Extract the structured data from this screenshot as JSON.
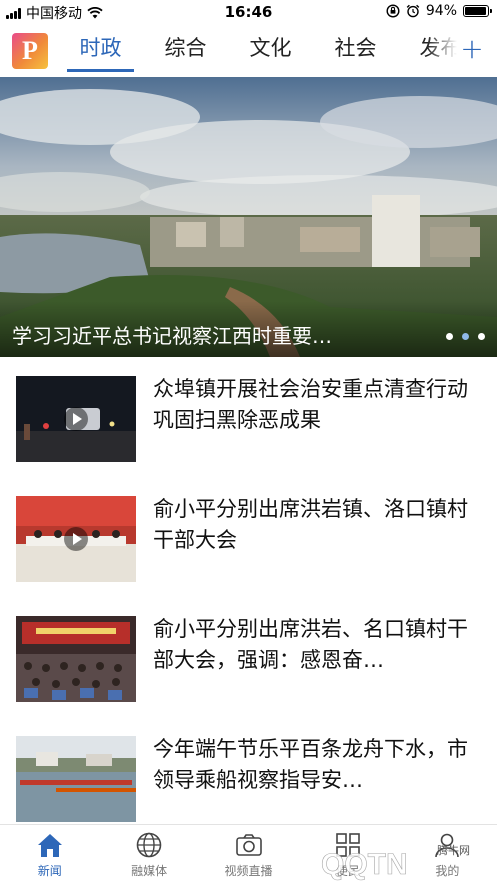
{
  "status_bar": {
    "carrier": "中国移动",
    "time": "16:46",
    "battery": "94%",
    "battery_level": 0.94
  },
  "header": {
    "logo_letter": "P",
    "tabs": [
      {
        "label": "时政",
        "active": true
      },
      {
        "label": "综合",
        "active": false
      },
      {
        "label": "文化",
        "active": false
      },
      {
        "label": "社会",
        "active": false
      },
      {
        "label": "发布",
        "active": false
      }
    ],
    "add_label": "+"
  },
  "banner": {
    "title": "学习习近平总书记视察江西时重要…",
    "page_count": 3,
    "active_page": 1
  },
  "news": [
    {
      "title": "众埠镇开展社会治安重点清查行动 巩固扫黑除恶成果",
      "has_video": true
    },
    {
      "title": "俞小平分别出席洪岩镇、洛口镇村干部大会",
      "has_video": true
    },
    {
      "title": "俞小平分别出席洪岩、名口镇村干部大会，强调：感恩奋…",
      "has_video": false
    },
    {
      "title": "今年端午节乐平百条龙舟下水，市领导乘船视察指导安…",
      "has_video": false
    }
  ],
  "bottom_nav": [
    {
      "label": "新闻",
      "icon": "home-icon",
      "active": true
    },
    {
      "label": "融媒体",
      "icon": "globe-icon",
      "active": false
    },
    {
      "label": "视频直播",
      "icon": "camera-icon",
      "active": false
    },
    {
      "label": "便民",
      "icon": "grid-icon",
      "active": false
    },
    {
      "label": "我的",
      "icon": "user-icon",
      "active": false
    }
  ],
  "watermark": {
    "text": "QQTN",
    "subtext": "腾牛网"
  },
  "colors": {
    "accent": "#2d67b8"
  }
}
